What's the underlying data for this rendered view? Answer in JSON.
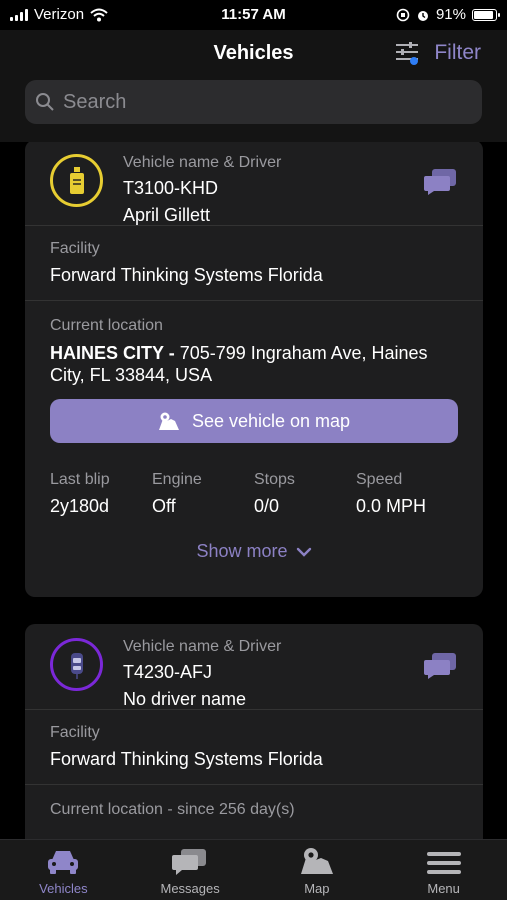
{
  "status": {
    "carrier": "Verizon",
    "time": "11:57 AM",
    "battery": "91%",
    "battery_level": 0.91
  },
  "header": {
    "title": "Vehicles",
    "filter_label": "Filter"
  },
  "search": {
    "placeholder": "Search"
  },
  "cards": [
    {
      "name_label": "Vehicle name & Driver",
      "vehicle": "T3100-KHD",
      "driver": "April Gillett",
      "facility_label": "Facility",
      "facility": "Forward Thinking Systems Florida",
      "location_label": "Current location",
      "location_city": "HAINES CITY -",
      "location_address": " 705-799 Ingraham Ave, Haines City, FL 33844, USA",
      "map_button": "See vehicle on map",
      "stats": [
        {
          "label": "Last blip",
          "value": "2y180d"
        },
        {
          "label": "Engine",
          "value": "Off"
        },
        {
          "label": "Stops",
          "value": "0/0"
        },
        {
          "label": "Speed",
          "value": "0.0 MPH"
        }
      ],
      "show_more": "Show more"
    },
    {
      "name_label": "Vehicle name & Driver",
      "vehicle": "T4230-AFJ",
      "driver": "No driver name",
      "facility_label": "Facility",
      "facility": "Forward Thinking Systems Florida",
      "location_label": "Current location - since 256 day(s)"
    }
  ],
  "tabs": [
    {
      "label": "Vehicles",
      "icon": "car-icon",
      "active": true
    },
    {
      "label": "Messages",
      "icon": "messages-icon"
    },
    {
      "label": "Map",
      "icon": "map-icon"
    },
    {
      "label": "Menu",
      "icon": "menu-icon"
    }
  ],
  "colors": {
    "accent": "#8c81c4",
    "yellow_ring": "#e7cd32",
    "purple_ring": "#7b28d8"
  }
}
